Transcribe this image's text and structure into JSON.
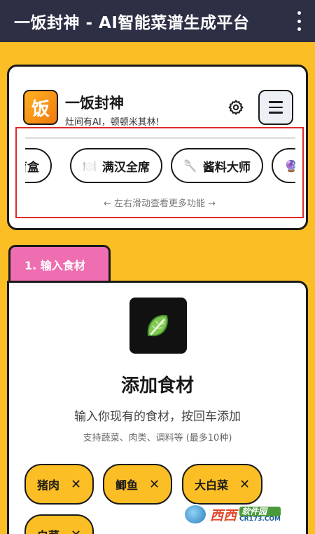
{
  "app": {
    "title": "一饭封神 - AI智能菜谱生成平台"
  },
  "header": {
    "logo_char": "饭",
    "brand_name": "一饭封神",
    "slogan": "灶间有AI，顿顿米其林!",
    "icons": {
      "settings": "gear-icon",
      "menu": "hamburger-icon"
    }
  },
  "features": {
    "chips": [
      {
        "label": "盲盒",
        "icon": ""
      },
      {
        "label": "满汉全席",
        "icon": "🍽️"
      },
      {
        "label": "酱料大师",
        "icon": "🥄"
      },
      {
        "label": "",
        "icon": "🔮"
      }
    ],
    "hint": "← 左右滑动查看更多功能 →"
  },
  "step": {
    "tab_label": "1. 输入食材",
    "icon": "leafy-green-icon",
    "title": "添加食材",
    "subtitle": "输入你现有的食材，按回车添加",
    "note": "支持蔬菜、肉类、调料等 (最多10种)",
    "ingredients": [
      "猪肉",
      "鲫鱼",
      "大白菜",
      "白菜"
    ],
    "remove_symbol": "✕"
  },
  "watermark": {
    "brand": "西西",
    "suffix": "软件园",
    "domain": "CR173.COM"
  },
  "colors": {
    "background": "#fbbe24",
    "titlebar": "#2d2f45",
    "tab": "#ee6eb1",
    "highlight_border": "#e02a2a",
    "logo_orange": "#f07a10"
  }
}
